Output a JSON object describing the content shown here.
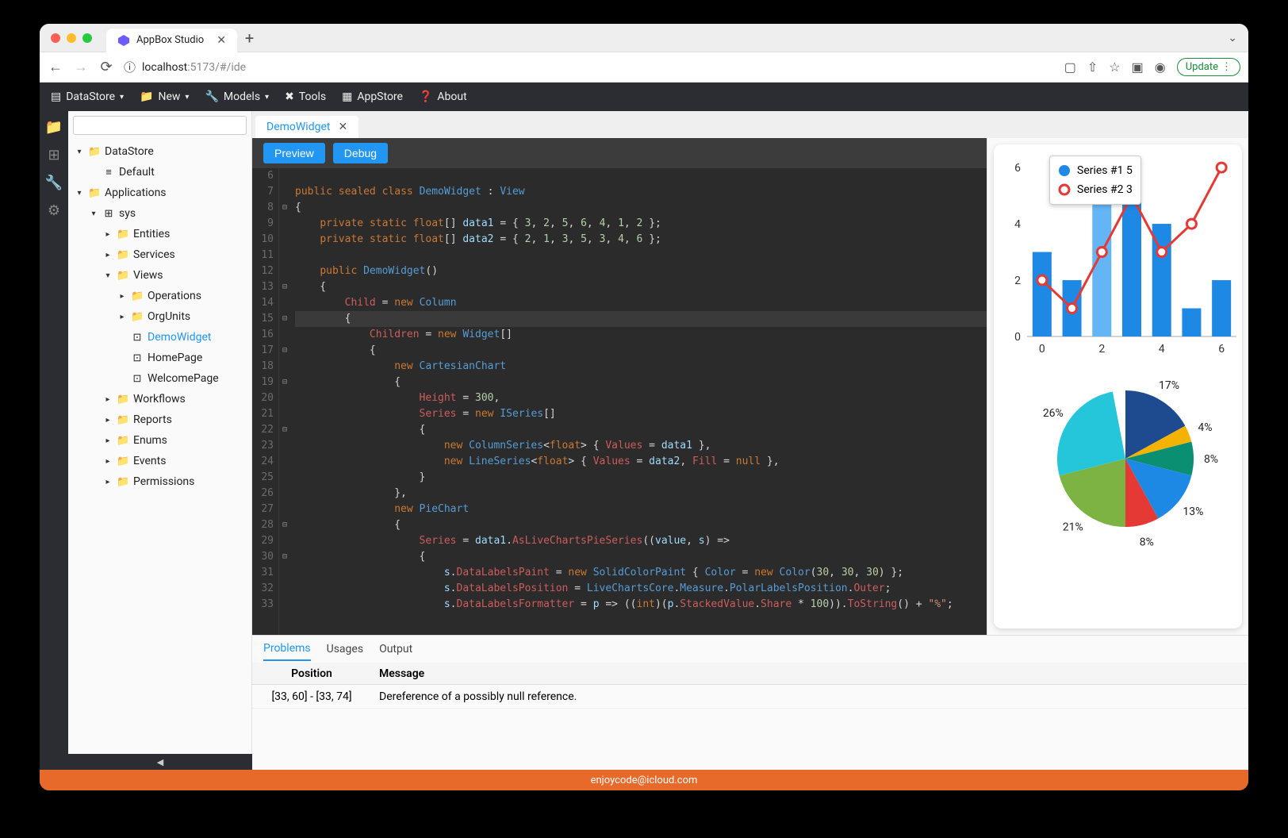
{
  "browser": {
    "tab_title": "AppBox Studio",
    "url_host": "localhost",
    "url_port": ":5173",
    "url_path": "/#/ide",
    "update_label": "Update"
  },
  "menubar": [
    {
      "icon": "datastore",
      "label": "DataStore",
      "chev": true
    },
    {
      "icon": "folder",
      "label": "New",
      "chev": true
    },
    {
      "icon": "wrench",
      "label": "Models",
      "chev": true
    },
    {
      "icon": "tools",
      "label": "Tools",
      "chev": false
    },
    {
      "icon": "package",
      "label": "AppStore",
      "chev": false
    },
    {
      "icon": "question",
      "label": "About",
      "chev": false
    }
  ],
  "sidebar": {
    "search_placeholder": "",
    "tree": [
      {
        "depth": 0,
        "caret": "down",
        "icon": "folder",
        "label": "DataStore"
      },
      {
        "depth": 1,
        "caret": "none",
        "icon": "db",
        "label": "Default"
      },
      {
        "depth": 0,
        "caret": "down",
        "icon": "folder",
        "label": "Applications"
      },
      {
        "depth": 1,
        "caret": "down",
        "icon": "apps",
        "label": "sys"
      },
      {
        "depth": 2,
        "caret": "right",
        "icon": "folder",
        "label": "Entities"
      },
      {
        "depth": 2,
        "caret": "right",
        "icon": "folder",
        "label": "Services"
      },
      {
        "depth": 2,
        "caret": "down",
        "icon": "folder",
        "label": "Views"
      },
      {
        "depth": 3,
        "caret": "right",
        "icon": "folder",
        "label": "Operations"
      },
      {
        "depth": 3,
        "caret": "right",
        "icon": "folder",
        "label": "OrgUnits"
      },
      {
        "depth": 3,
        "caret": "none",
        "icon": "widget",
        "label": "DemoWidget",
        "selected": true
      },
      {
        "depth": 3,
        "caret": "none",
        "icon": "widget",
        "label": "HomePage"
      },
      {
        "depth": 3,
        "caret": "none",
        "icon": "widget",
        "label": "WelcomePage"
      },
      {
        "depth": 2,
        "caret": "right",
        "icon": "folder",
        "label": "Workflows"
      },
      {
        "depth": 2,
        "caret": "right",
        "icon": "folder",
        "label": "Reports"
      },
      {
        "depth": 2,
        "caret": "right",
        "icon": "folder",
        "label": "Enums"
      },
      {
        "depth": 2,
        "caret": "right",
        "icon": "folder",
        "label": "Events"
      },
      {
        "depth": 2,
        "caret": "right",
        "icon": "folder",
        "label": "Permissions"
      }
    ]
  },
  "open_file_tab": "DemoWidget",
  "actions": {
    "preview": "Preview",
    "debug": "Debug"
  },
  "code": {
    "first_line_no": 6,
    "current_line": 15,
    "lines": [
      "",
      "public sealed class DemoWidget : View",
      "{",
      "    private static float[] data1 = { 3, 2, 5, 6, 4, 1, 2 };",
      "    private static float[] data2 = { 2, 1, 3, 5, 3, 4, 6 };",
      "",
      "    public DemoWidget()",
      "    {",
      "        Child = new Column",
      "        {",
      "            Children = new Widget[]",
      "            {",
      "                new CartesianChart",
      "                {",
      "                    Height = 300,",
      "                    Series = new ISeries[]",
      "                    {",
      "                        new ColumnSeries<float> { Values = data1 },",
      "                        new LineSeries<float> { Values = data2, Fill = null },",
      "                    }",
      "                },",
      "                new PieChart",
      "                {",
      "                    Series = data1.AsLiveChartsPieSeries((value, s) =>",
      "                    {",
      "                        s.DataLabelsPaint = new SolidColorPaint { Color = new Color(30, 30, 30) };",
      "                        s.DataLabelsPosition = LiveChartsCore.Measure.PolarLabelsPosition.Outer;",
      "                        s.DataLabelsFormatter = p => ((int)(p.StackedValue.Share * 100)).ToString() + \"%\";"
    ],
    "fold_rows": [
      8,
      13,
      15,
      17,
      19,
      22,
      28,
      30
    ]
  },
  "bottom": {
    "tabs": [
      "Problems",
      "Usages",
      "Output"
    ],
    "active_tab": 0,
    "columns": [
      "Position",
      "Message"
    ],
    "rows": [
      {
        "position": "[33, 60] - [33, 74]",
        "message": "Dereference of a possibly null reference."
      }
    ]
  },
  "footer": "enjoycode@icloud.com",
  "chart_data": [
    {
      "type": "bar+line",
      "x": [
        0,
        1,
        2,
        3,
        4,
        5,
        6
      ],
      "bar_values": [
        3,
        2,
        5,
        6,
        4,
        1,
        2
      ],
      "line_values": [
        2,
        1,
        3,
        5,
        3,
        4,
        6
      ],
      "ylim": [
        0,
        6
      ],
      "xticks": [
        0,
        2,
        4,
        6
      ],
      "yticks": [
        0,
        2,
        4,
        6
      ],
      "legend": [
        {
          "name": "Series #1",
          "value": 5,
          "color": "#1e88e5",
          "marker": "circle"
        },
        {
          "name": "Series #2",
          "value": 3,
          "color": "#e53935",
          "marker": "ring"
        }
      ]
    },
    {
      "type": "pie",
      "slices": [
        {
          "label": "17%",
          "value": 17,
          "color": "#1e4b8f"
        },
        {
          "label": "4%",
          "value": 4,
          "color": "#f5b301"
        },
        {
          "label": "8%",
          "value": 8,
          "color": "#0a8f72"
        },
        {
          "label": "13%",
          "value": 13,
          "color": "#1e88e5"
        },
        {
          "label": "8%",
          "value": 8,
          "color": "#e53935"
        },
        {
          "label": "21%",
          "value": 21,
          "color": "#7cb342"
        },
        {
          "label": "26%",
          "value": 26,
          "color": "#26c6da"
        }
      ]
    }
  ]
}
